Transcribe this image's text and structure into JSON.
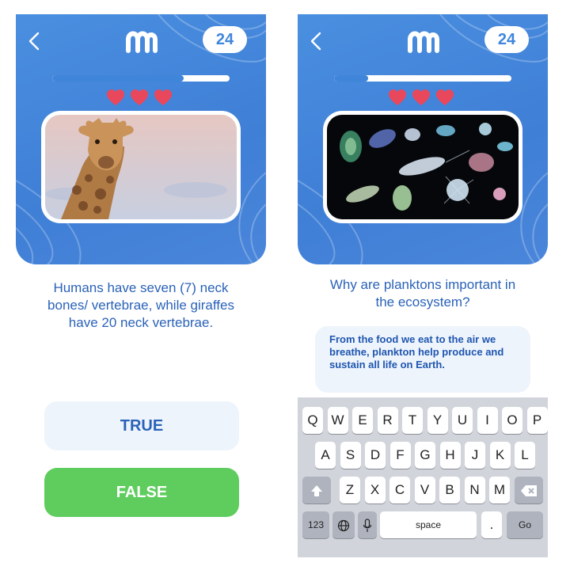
{
  "colors": {
    "header_blue": "#4a8fe0",
    "progress_fill": "#3f85d9",
    "heart": "#e9475c",
    "question_text": "#2a62b8",
    "true_button_bg": "#eef4fc",
    "false_button_bg": "#5fcd5e",
    "keyboard_bg": "#d1d4da"
  },
  "left_screen": {
    "score": "24",
    "progress": 0.74,
    "hearts": 3,
    "image": "giraffe-photo",
    "question": "Humans have seven (7) neck bones/ vertebrae, while giraffes have 20 neck vertebrae.",
    "true_label": "TRUE",
    "false_label": "FALSE"
  },
  "right_screen": {
    "score": "24",
    "progress": 0.19,
    "hearts": 3,
    "image": "plankton-photo",
    "question": "Why are planktons important in the ecosystem?",
    "answer_text": "From the food we eat to the air we breathe, plankton help produce and sustain all life on Earth.",
    "keyboard": {
      "row1": [
        "Q",
        "W",
        "E",
        "R",
        "T",
        "Y",
        "U",
        "I",
        "O",
        "P"
      ],
      "row2": [
        "A",
        "S",
        "D",
        "F",
        "G",
        "H",
        "J",
        "K",
        "L"
      ],
      "row3": [
        "Z",
        "X",
        "C",
        "V",
        "B",
        "N",
        "M"
      ],
      "numbers_label": "123",
      "space_label": "space",
      "period_label": ".",
      "go_label": "Go"
    }
  },
  "icons": [
    "back-chevron-icon",
    "app-logo-icon",
    "heart-icon",
    "shift-icon",
    "backspace-icon",
    "globe-icon",
    "microphone-icon"
  ]
}
